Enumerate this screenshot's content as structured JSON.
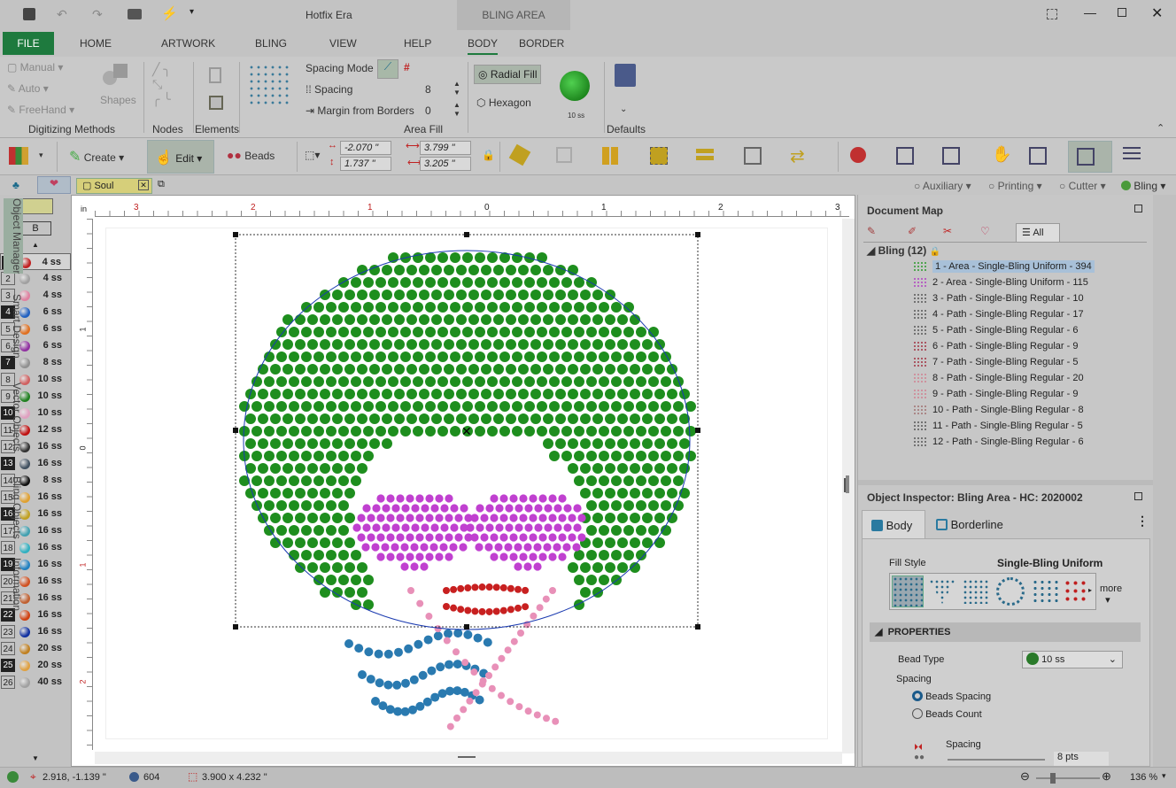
{
  "app": {
    "title": "Hotfix Era",
    "context_tab": "BLING AREA"
  },
  "tabs": [
    "FILE",
    "HOME",
    "ARTWORK",
    "BLING",
    "VIEW",
    "HELP",
    "BODY",
    "BORDER"
  ],
  "ribbon": {
    "digitizing": {
      "manual": "Manual",
      "auto": "Auto",
      "freehand": "FreeHand",
      "shapes": "Shapes",
      "title": "Digitizing Methods"
    },
    "nodes_title": "Nodes",
    "elements_title": "Elements",
    "area_fill": {
      "spacing_mode": "Spacing Mode",
      "spacing": "Spacing",
      "spacing_val": "8",
      "margin": "Margin from Borders",
      "margin_val": "0",
      "title": "Area Fill"
    },
    "radial": "Radial Fill",
    "hexagon": "Hexagon",
    "bead_size": "10 ss",
    "defaults_title": "Defaults"
  },
  "toolbar": {
    "create": "Create",
    "edit": "Edit",
    "beads": "Beads",
    "x": "-2.070 \"",
    "y": "1.737 \"",
    "w": "3.799 \"",
    "h": "3.205 \""
  },
  "subbar": {
    "doc_tab": "Soul",
    "auxiliary": "Auxiliary",
    "printing": "Printing",
    "cutter": "Cutter",
    "bling": "Bling"
  },
  "left_panel": {
    "b_label": "B"
  },
  "colors": [
    {
      "n": "1",
      "c": "#c02020",
      "s": "4 ss"
    },
    {
      "n": "2",
      "c": "#a0a0a0",
      "s": "4 ss"
    },
    {
      "n": "3",
      "c": "#e080a0",
      "s": "4 ss"
    },
    {
      "n": "4",
      "c": "#2060c0",
      "s": "6 ss"
    },
    {
      "n": "5",
      "c": "#e07020",
      "s": "6 ss"
    },
    {
      "n": "6",
      "c": "#9030a0",
      "s": "6 ss"
    },
    {
      "n": "7",
      "c": "#909090",
      "s": "8 ss"
    },
    {
      "n": "8",
      "c": "#d06060",
      "s": "10 ss"
    },
    {
      "n": "9",
      "c": "#208020",
      "s": "10 ss"
    },
    {
      "n": "10",
      "c": "#e0a0c0",
      "s": "10 ss"
    },
    {
      "n": "11",
      "c": "#c01010",
      "s": "12 ss"
    },
    {
      "n": "12",
      "c": "#303030",
      "s": "16 ss"
    },
    {
      "n": "13",
      "c": "#405060",
      "s": "16 ss"
    },
    {
      "n": "14",
      "c": "#101010",
      "s": "8 ss"
    },
    {
      "n": "15",
      "c": "#e0a030",
      "s": "16 ss"
    },
    {
      "n": "16",
      "c": "#c0a020",
      "s": "16 ss"
    },
    {
      "n": "17",
      "c": "#40a0b0",
      "s": "16 ss"
    },
    {
      "n": "18",
      "c": "#30b0c0",
      "s": "16 ss"
    },
    {
      "n": "19",
      "c": "#2080c0",
      "s": "16 ss"
    },
    {
      "n": "20",
      "c": "#d05020",
      "s": "16 ss"
    },
    {
      "n": "21",
      "c": "#c06030",
      "s": "16 ss"
    },
    {
      "n": "22",
      "c": "#d04010",
      "s": "16 ss"
    },
    {
      "n": "23",
      "c": "#1030a0",
      "s": "16 ss"
    },
    {
      "n": "24",
      "c": "#c08020",
      "s": "20 ss"
    },
    {
      "n": "25",
      "c": "#e0a040",
      "s": "20 ss"
    },
    {
      "n": "26",
      "c": "#a0a0a0",
      "s": "40 ss"
    }
  ],
  "ruler": {
    "unit": "in",
    "top": [
      "3",
      "2",
      "1",
      "0",
      "1",
      "2",
      "3"
    ],
    "left": [
      "1",
      "0",
      "1",
      "2"
    ]
  },
  "document_map": {
    "title": "Document Map",
    "all": "All",
    "group": "Bling (12)",
    "items": [
      {
        "label": "1 - Area - Single-Bling Uniform - 394",
        "c": "#2a9a2a"
      },
      {
        "label": "2 - Area - Single-Bling Uniform - 115",
        "c": "#b040c0"
      },
      {
        "label": "3 - Path - Single-Bling Regular - 10",
        "c": "#555"
      },
      {
        "label": "4 - Path - Single-Bling Regular - 17",
        "c": "#555"
      },
      {
        "label": "5 - Path - Single-Bling Regular - 6",
        "c": "#555"
      },
      {
        "label": "6 - Path - Single-Bling Regular - 9",
        "c": "#a03040"
      },
      {
        "label": "7 - Path - Single-Bling Regular - 5",
        "c": "#a03040"
      },
      {
        "label": "8 - Path - Single-Bling Regular - 20",
        "c": "#d08090"
      },
      {
        "label": "9 - Path - Single-Bling Regular - 9",
        "c": "#d08090"
      },
      {
        "label": "10 - Path - Single-Bling Regular - 8",
        "c": "#a07070"
      },
      {
        "label": "11 - Path - Single-Bling Regular - 5",
        "c": "#555"
      },
      {
        "label": "12 - Path - Single-Bling Regular - 6",
        "c": "#555"
      }
    ]
  },
  "inspector": {
    "title": "Object Inspector: Bling Area - HC: 2020002",
    "body_tab": "Body",
    "border_tab": "Borderline",
    "fill_style_label": "Fill Style",
    "fill_style_value": "Single-Bling Uniform",
    "more": "more",
    "properties": "PROPERTIES",
    "bead_type_label": "Bead Type",
    "bead_type_value": "10 ss",
    "spacing_label": "Spacing",
    "beads_spacing": "Beads Spacing",
    "beads_count": "Beads Count",
    "spacing_slider_label": "Spacing",
    "spacing_slider_value": "8 pts"
  },
  "side_tabs": [
    "Object Manager",
    "Smart Design",
    "Vector Objects",
    "Bling Objects",
    "Information"
  ],
  "status": {
    "coords": "2.918, -1.139 \"",
    "count": "604",
    "size": "3.900 x 4.232 \"",
    "zoom": "136 %"
  },
  "accent": "#1e7a3e"
}
